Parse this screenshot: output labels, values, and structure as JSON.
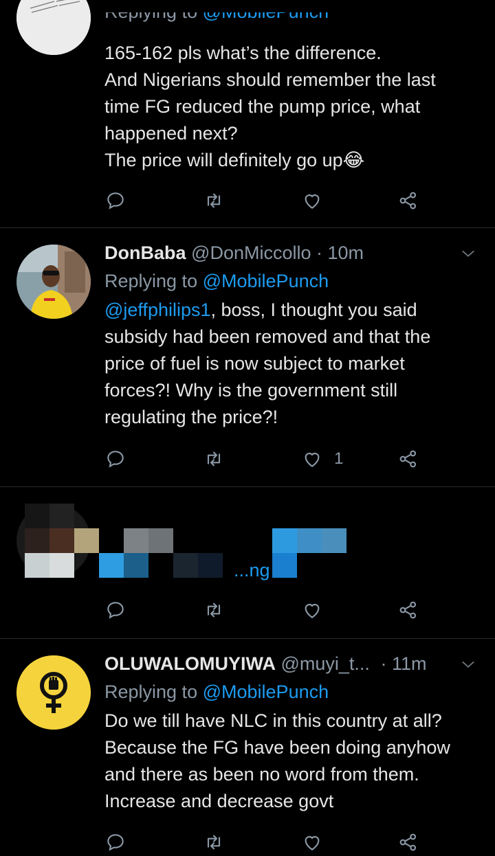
{
  "tweets": [
    {
      "reply_prefix": "Replying to",
      "reply_handle": "@MobilePunch",
      "text": "165-162 pls what’s the difference.\nAnd Nigerians should remember the last time FG reduced the pump price, what happened next?\nThe price will definitely go up😂",
      "likes": ""
    },
    {
      "name": "DonBaba",
      "handle": "@DonMiccollo",
      "time": "· 10m",
      "reply_prefix": "Replying to",
      "reply_handle": "@MobilePunch",
      "mention": "@jeffphilips1",
      "text": ", boss, I thought you said subsidy had been removed and that the price of fuel is now subject to market forces?! Why is the government still regulating the price?!",
      "likes": "1"
    },
    {
      "name": "OLUWALOMUYIWA",
      "handle": "@muyi_t...",
      "time": "· 11m",
      "reply_prefix": "Replying to",
      "reply_handle": "@MobilePunch",
      "text": "Do we till have NLC in this country at all? Because the FG have been doing anyhow and there as been no word from them. Increase and decrease govt",
      "likes": ""
    }
  ],
  "censored_tweet": {
    "visible_fragment": "...ng"
  },
  "icons": [
    "reply-icon",
    "retweet-icon",
    "like-icon",
    "share-icon",
    "chevron-down-icon"
  ],
  "colors": {
    "background": "#000000",
    "link": "#1d9bf0",
    "muted": "#8b98a5",
    "text": "#e6e6e6",
    "avatar_yellow": "#f5d33c"
  }
}
